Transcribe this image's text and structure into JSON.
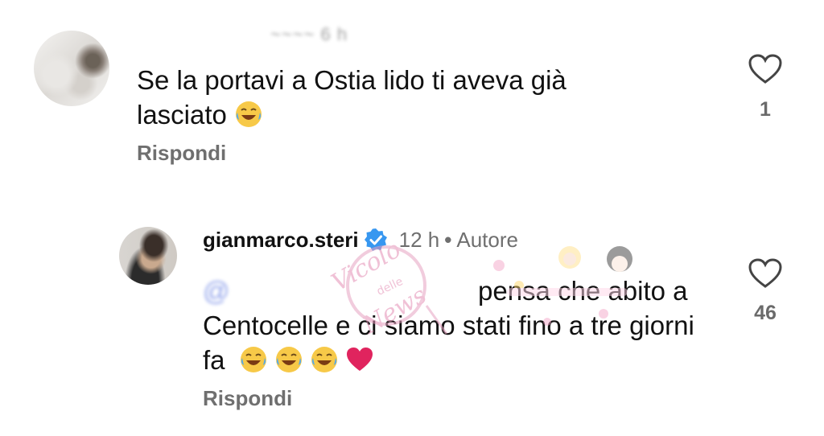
{
  "comments": [
    {
      "username": "~~~~",
      "time": "6 h",
      "text": "Se la portavi a Ostia lido ti aveva già lasciato",
      "reply_label": "Rispondi",
      "likes": "1"
    },
    {
      "username": "gianmarco.steri",
      "time": "12 h",
      "badge": "Autore",
      "mention": "@",
      "text": "pensa che abito a Centocelle e ci siamo stati fino a tre giorni fa",
      "reply_label": "Rispondi",
      "likes": "46"
    }
  ],
  "watermark": {
    "text": "Vicolo delle News"
  },
  "colors": {
    "verified": "#3797f0",
    "heart": "#444444",
    "muted": "#6f6f6f"
  }
}
